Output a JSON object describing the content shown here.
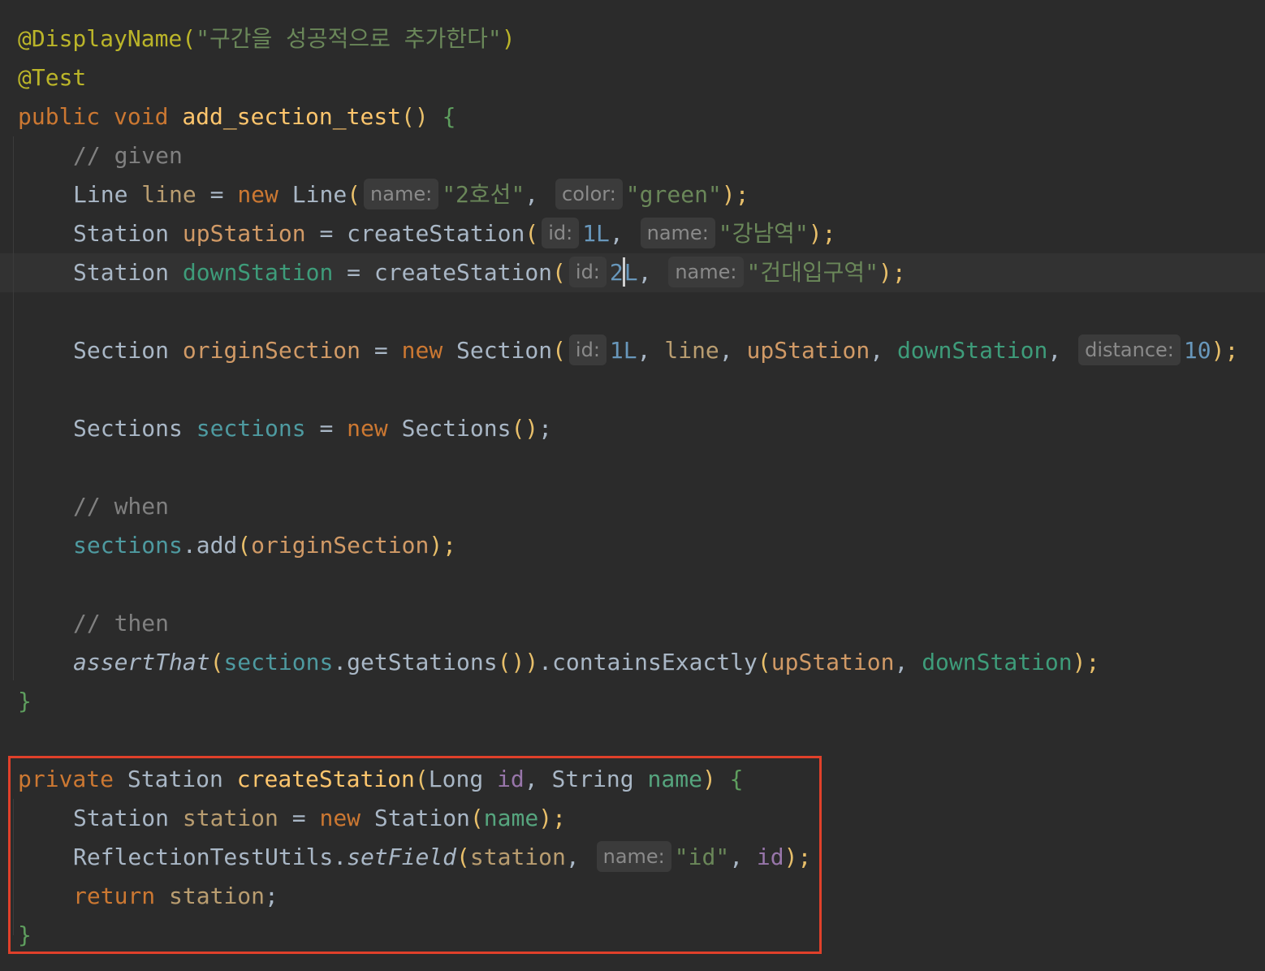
{
  "code": {
    "l1": {
      "ann": "@DisplayName(",
      "str": "\"구간을 성공적으로 추가한다\"",
      "close": ")"
    },
    "l2": {
      "ann": "@Test"
    },
    "l3": {
      "kw1": "public",
      "kw2": "void",
      "fn": "add_section_test",
      "paren": "()",
      "brace": "{"
    },
    "l4": {
      "cmt": "// given"
    },
    "l5": {
      "type": "Line",
      "var": "line",
      "eq": "=",
      "kw": "new",
      "ctor": "Line",
      "open": "(",
      "hint1": "name:",
      "str1": "\"2호선\"",
      "comma": ",",
      "hint2": "color:",
      "str2": "\"green\"",
      "close": ");"
    },
    "l6": {
      "type": "Station",
      "var": "upStation",
      "eq": "=",
      "fn": "createStation",
      "open": "(",
      "hint1": "id:",
      "num": "1L",
      "comma": ",",
      "hint2": "name:",
      "str": "\"강남역\"",
      "close": ");"
    },
    "l7": {
      "type": "Station",
      "var": "downStation",
      "eq": "=",
      "fn": "createStation",
      "open": "(",
      "hint1": "id:",
      "num_a": "2",
      "num_b": "L",
      "comma": ",",
      "hint2": "name:",
      "str": "\"건대입구역\"",
      "close": ");"
    },
    "l8": {
      "type": "Section",
      "var": "originSection",
      "eq": "=",
      "kw": "new",
      "ctor": "Section",
      "open": "(",
      "hint1": "id:",
      "num": "1L",
      "c1": ",",
      "a1": "line",
      "c2": ",",
      "a2": "upStation",
      "c3": ",",
      "a3": "downStation",
      "c4": ",",
      "hint2": "distance:",
      "num2": "10",
      "close": ");"
    },
    "l9": {
      "type": "Sections",
      "var": "sections",
      "eq": "=",
      "kw": "new",
      "ctor": "Sections",
      "paren": "()",
      "semi": ";"
    },
    "l10": {
      "cmt": "// when"
    },
    "l11": {
      "var": "sections",
      "dot": ".add",
      "open": "(",
      "arg": "originSection",
      "close": ");"
    },
    "l12": {
      "cmt": "// then"
    },
    "l13": {
      "fn": "assertThat",
      "open": "(",
      "var": "sections",
      "call": ".getStations",
      "paren": "()",
      "close1": ")",
      "call2": ".containsExactly",
      "open2": "(",
      "a1": "upStation",
      "comma": ",",
      "a2": "downStation",
      "close2": ");"
    },
    "l14": {
      "brace": "}"
    },
    "l15": {
      "kw": "private",
      "type": "Station",
      "fn": "createStation",
      "open": "(",
      "t1": "Long",
      "p1": "id",
      "comma": ",",
      "t2": "String",
      "p2": "name",
      "close": ")",
      "brace": "{"
    },
    "l16": {
      "type": "Station",
      "var": "station",
      "eq": "=",
      "kw": "new",
      "ctor": "Station",
      "open": "(",
      "arg": "name",
      "close": ");"
    },
    "l17": {
      "cls": "ReflectionTestUtils",
      "dot": ".",
      "fn": "setField",
      "open": "(",
      "arg": "station",
      "comma": ",",
      "hint": "name:",
      "str": "\"id\"",
      "comma2": ",",
      "p": "id",
      "close": ");"
    },
    "l18": {
      "kw": "return",
      "var": "station",
      "semi": ";"
    },
    "l19": {
      "brace": "}"
    }
  },
  "colors": {
    "background": "#2b2b2b",
    "highlight_border": "#e0402a"
  }
}
